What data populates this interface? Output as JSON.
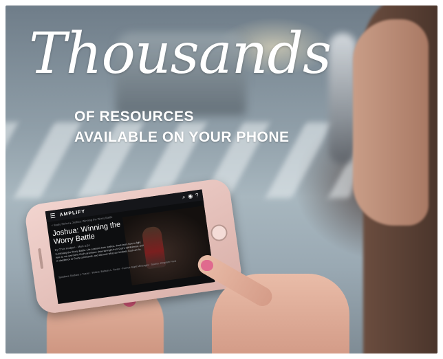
{
  "headline": {
    "script_word": "Thousands",
    "line1": "OF RESOURCES",
    "line2": "AVAILABLE ON YOUR PHONE"
  },
  "phone_screen": {
    "brand": "AMPLIFY",
    "breadcrumb": "< Study Series  ▸  Joshua: Winning the Worry Battle",
    "title": "Joshua: Winning the Worry Battle",
    "byline": "By Chris Hodges · Mark 2:24",
    "body": "In Winning the Worry Battle: Life Lessons from Joshua, Trent learn how to fight fear as we overcome God's promises; draw strength from God's faithfulness; and in obedience to God's commands, and discover what our limitless God can do.",
    "meta": "Speakers: Barbara L. Tozzer · Writers: Barbara L. Tozzer · Format: Eight Messages · Source: Kingdom Frost"
  }
}
